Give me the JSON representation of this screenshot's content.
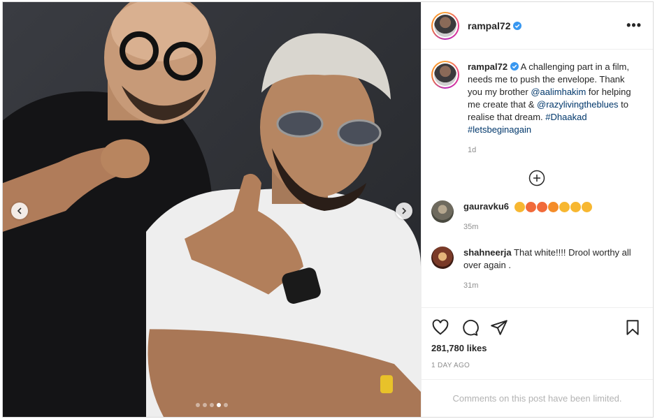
{
  "post": {
    "author": "rampal72",
    "caption_user": "rampal72",
    "caption_text_1": "A challenging part in a film, needs me to push the envelope. Thank you my brother",
    "caption_mention_1": "@aalimhakim",
    "caption_text_2": "for helping me create that &",
    "caption_mention_2": "@razylivingtheblues",
    "caption_text_3": "to realise that dream.",
    "caption_tag_1": "#Dhaakad",
    "caption_tag_2": "#letsbeginagain",
    "caption_time": "1d",
    "more_label": "•••"
  },
  "comments": [
    {
      "user": "gauravku6",
      "text": "",
      "time": "35m",
      "emojis": [
        "#f7b731",
        "#f16a3a",
        "#f16a3a",
        "#f48c29",
        "#f7b731",
        "#f7b731",
        "#f7b731"
      ]
    },
    {
      "user": "shahneerja",
      "text": "That white!!!! Drool worthy all over again .",
      "time": "31m"
    }
  ],
  "stats": {
    "likes": "281,780 likes",
    "date": "1 DAY AGO"
  },
  "footer": {
    "limited": "Comments on this post have been limited."
  },
  "carousel": {
    "dots": 5,
    "active_dot": 3
  },
  "colors": {
    "link": "#00376b",
    "muted": "#8e8e8e",
    "verified": "#3897f0"
  }
}
